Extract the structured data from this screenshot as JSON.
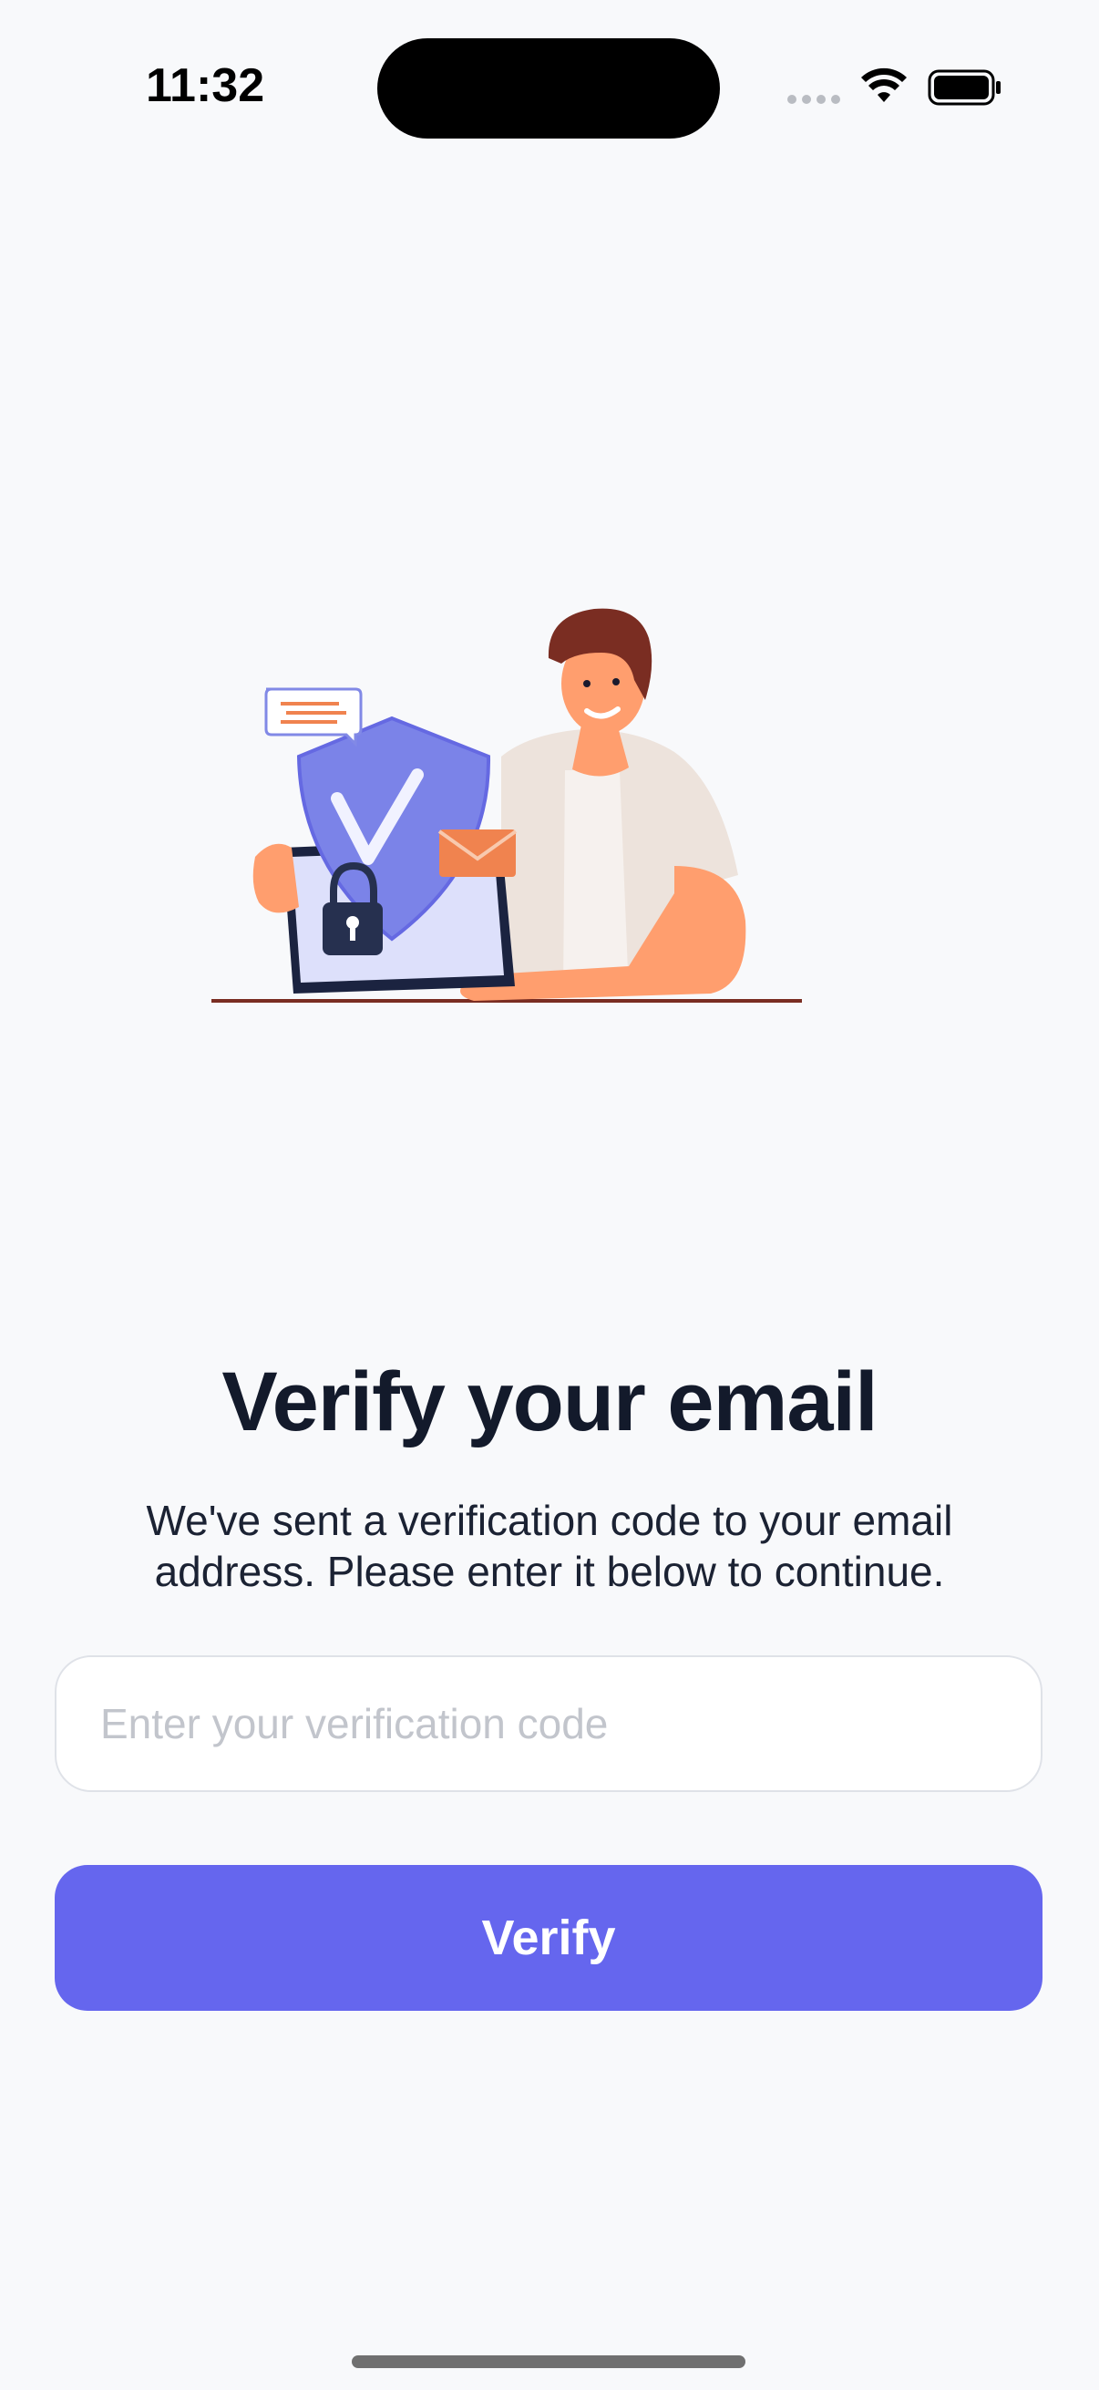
{
  "status_bar": {
    "time": "11:32"
  },
  "content": {
    "title": "Verify your email",
    "subtitle": "We've sent a verification code to your email address. Please enter it below to continue.",
    "code_input": {
      "placeholder": "Enter your verification code",
      "value": ""
    },
    "verify_button_label": "Verify"
  },
  "colors": {
    "background": "#f8f9fb",
    "accent": "#6566ee",
    "title_text": "#131a2b",
    "shield": "#7b83e8",
    "skin": "#ff9e6e",
    "hair": "#7a2d22"
  },
  "icons": {
    "wifi": "wifi-icon",
    "battery": "battery-icon",
    "signal": "cellular-signal-icon"
  }
}
